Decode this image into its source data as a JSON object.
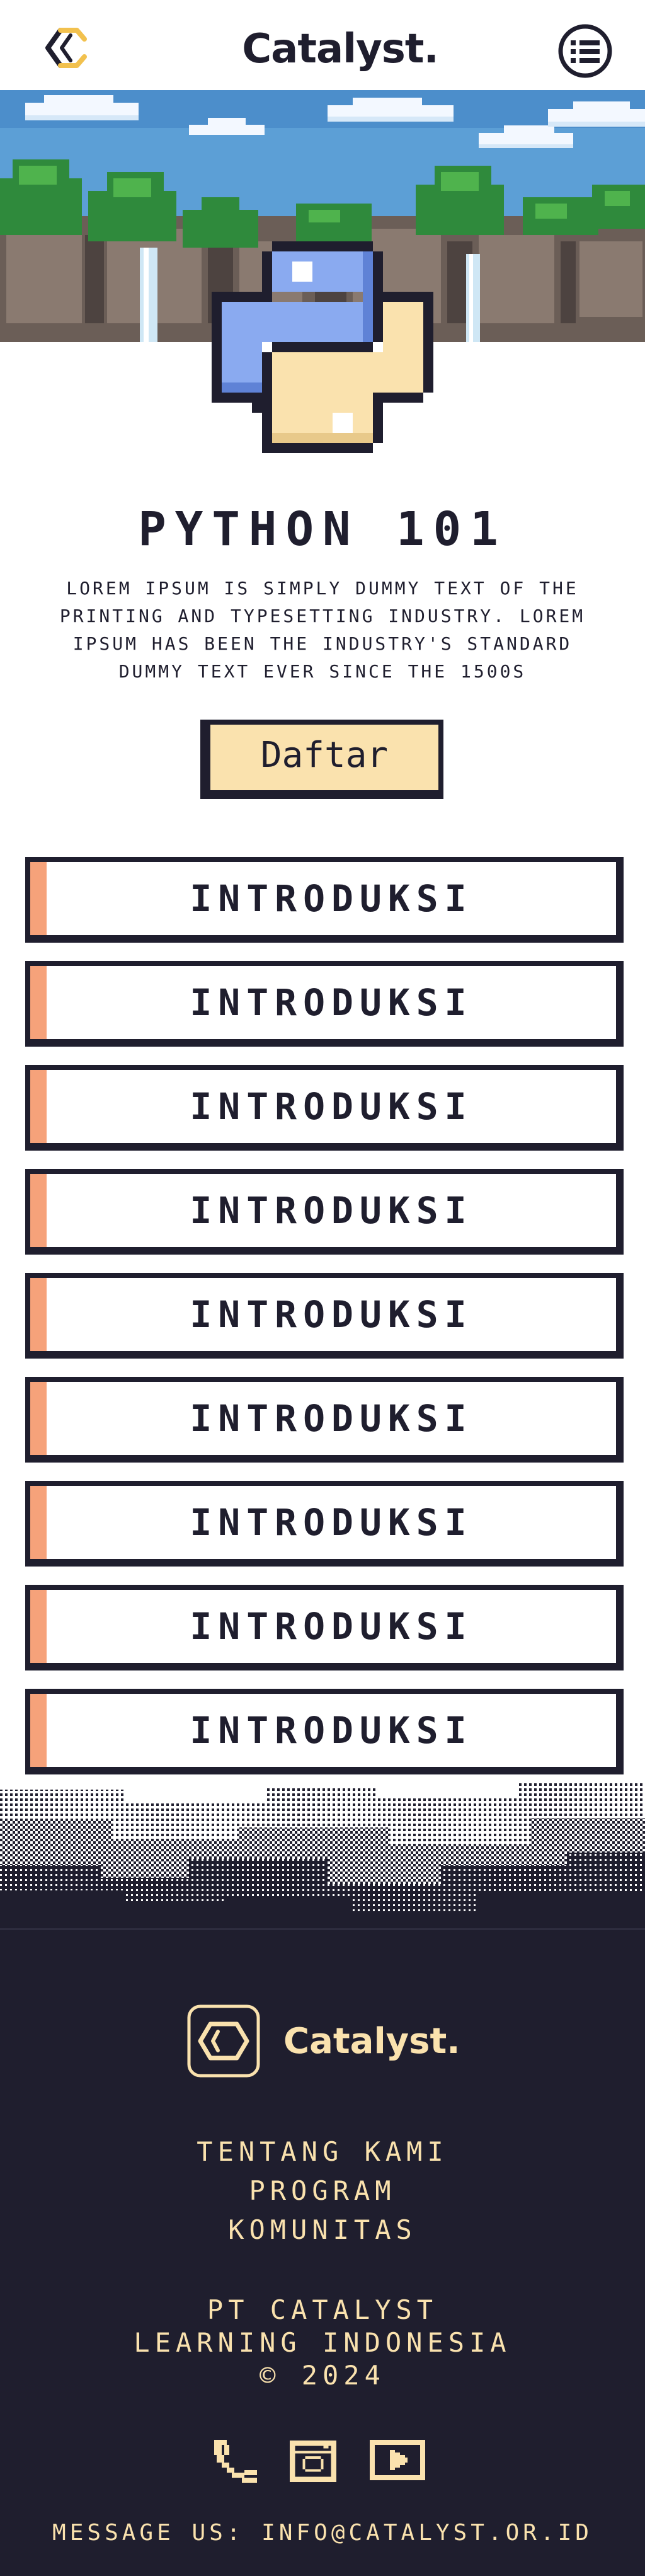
{
  "header": {
    "brand": "Catalyst.",
    "logo_icon": "hexagon-chevron-logo-icon",
    "menu_icon": "menu-list-icon"
  },
  "hero": {
    "scene": "pixel-art waterfall landscape",
    "badge_icon": "python-logo-icon",
    "title": "PYTHON 101",
    "description": "Lorem Ipsum is simply dummy text of the printing and typesetting industry. Lorem Ipsum has been the industry's standard dummy text ever since the 1500s",
    "cta_label": "Daftar"
  },
  "modules": [
    {
      "label": "INTRODUKSI"
    },
    {
      "label": "INTRODUKSI"
    },
    {
      "label": "INTRODUKSI"
    },
    {
      "label": "INTRODUKSI"
    },
    {
      "label": "INTRODUKSI"
    },
    {
      "label": "INTRODUKSI"
    },
    {
      "label": "INTRODUKSI"
    },
    {
      "label": "INTRODUKSI"
    },
    {
      "label": "INTRODUKSI"
    }
  ],
  "footer": {
    "brand": "Catalyst.",
    "links": [
      "TENTANG KAMI",
      "PROGRAM",
      "KOMUNITAS"
    ],
    "company_line1": "PT CATALYST",
    "company_line2": "LEARNING INDONESIA",
    "company_line3": "© 2024",
    "social_icons": [
      "phone-icon",
      "instagram-icon",
      "youtube-icon"
    ],
    "mail": "MESSAGE US: INFO@CATALYST.OR.ID"
  },
  "colors": {
    "ink": "#1f1e2e",
    "cream": "#fae2ae",
    "accent": "#f6a27a",
    "python_blue": "#8aaaf0"
  }
}
